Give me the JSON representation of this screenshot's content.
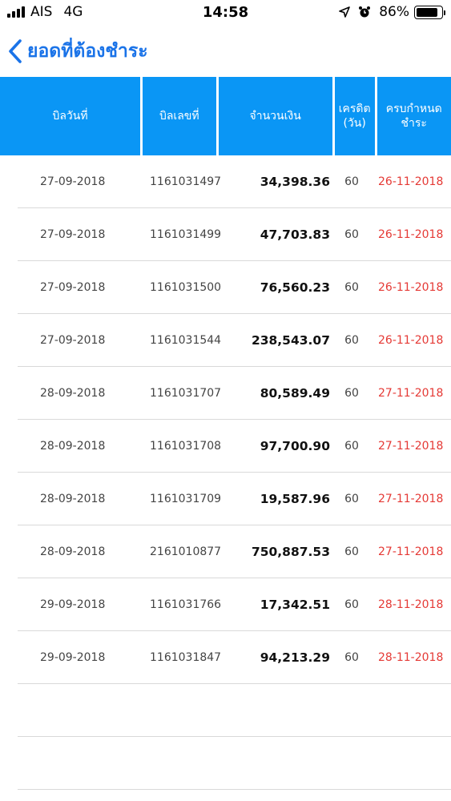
{
  "status_bar": {
    "carrier": "AIS",
    "network": "4G",
    "time": "14:58",
    "battery": "86%",
    "battery_level": 0.86
  },
  "nav": {
    "title": "ยอดที่ต้องชำระ"
  },
  "table": {
    "headers": {
      "bill_date": "บิลวันที่",
      "bill_no": "บิลเลขที่",
      "amount": "จำนวนเงิน",
      "credit_line1": "เครดิต",
      "credit_line2": "(วัน)",
      "due_line1": "ครบกำหนด",
      "due_line2": "ชำระ"
    },
    "rows": [
      {
        "bill_date": "27-09-2018",
        "bill_no": "1161031497",
        "amount": "34,398.36",
        "credit": "60",
        "due": "26-11-2018"
      },
      {
        "bill_date": "27-09-2018",
        "bill_no": "1161031499",
        "amount": "47,703.83",
        "credit": "60",
        "due": "26-11-2018"
      },
      {
        "bill_date": "27-09-2018",
        "bill_no": "1161031500",
        "amount": "76,560.23",
        "credit": "60",
        "due": "26-11-2018"
      },
      {
        "bill_date": "27-09-2018",
        "bill_no": "1161031544",
        "amount": "238,543.07",
        "credit": "60",
        "due": "26-11-2018"
      },
      {
        "bill_date": "28-09-2018",
        "bill_no": "1161031707",
        "amount": "80,589.49",
        "credit": "60",
        "due": "27-11-2018"
      },
      {
        "bill_date": "28-09-2018",
        "bill_no": "1161031708",
        "amount": "97,700.90",
        "credit": "60",
        "due": "27-11-2018"
      },
      {
        "bill_date": "28-09-2018",
        "bill_no": "1161031709",
        "amount": "19,587.96",
        "credit": "60",
        "due": "27-11-2018"
      },
      {
        "bill_date": "28-09-2018",
        "bill_no": "2161010877",
        "amount": "750,887.53",
        "credit": "60",
        "due": "27-11-2018"
      },
      {
        "bill_date": "29-09-2018",
        "bill_no": "1161031766",
        "amount": "17,342.51",
        "credit": "60",
        "due": "28-11-2018"
      },
      {
        "bill_date": "29-09-2018",
        "bill_no": "1161031847",
        "amount": "94,213.29",
        "credit": "60",
        "due": "28-11-2018"
      }
    ]
  },
  "colors": {
    "header_bg": "#0a96f5",
    "accent": "#1a73e8",
    "due_text": "#e53935"
  }
}
